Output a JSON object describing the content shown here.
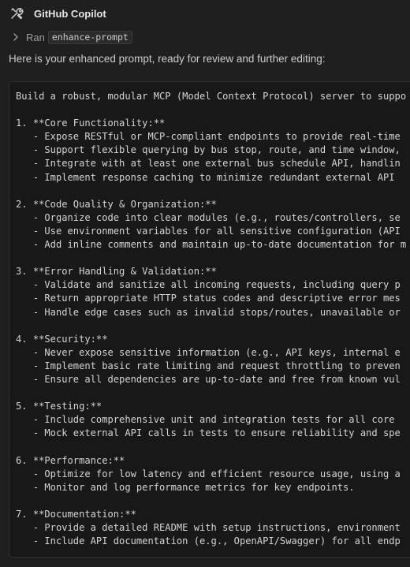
{
  "header": {
    "icon": "copilot-tools-icon",
    "title": "GitHub Copilot"
  },
  "tool_run": {
    "icon": "chevron-right-icon",
    "label": "Ran",
    "command": "enhance-prompt"
  },
  "intro_text": "Here is your enhanced prompt, ready for review and further editing:",
  "code_block": {
    "lines": [
      "Build a robust, modular MCP (Model Context Protocol) server to suppo",
      "",
      "1. **Core Functionality:**",
      "   - Expose RESTful or MCP-compliant endpoints to provide real-time",
      "   - Support flexible querying by bus stop, route, and time window,",
      "   - Integrate with at least one external bus schedule API, handlin",
      "   - Implement response caching to minimize redundant external API",
      "",
      "2. **Code Quality & Organization:**",
      "   - Organize code into clear modules (e.g., routes/controllers, se",
      "   - Use environment variables for all sensitive configuration (API",
      "   - Add inline comments and maintain up-to-date documentation for m",
      "",
      "3. **Error Handling & Validation:**",
      "   - Validate and sanitize all incoming requests, including query p",
      "   - Return appropriate HTTP status codes and descriptive error mes",
      "   - Handle edge cases such as invalid stops/routes, unavailable or",
      "",
      "4. **Security:**",
      "   - Never expose sensitive information (e.g., API keys, internal e",
      "   - Implement basic rate limiting and request throttling to preven",
      "   - Ensure all dependencies are up-to-date and free from known vul",
      "",
      "5. **Testing:**",
      "   - Include comprehensive unit and integration tests for all core",
      "   - Mock external API calls in tests to ensure reliability and spe",
      "",
      "6. **Performance:**",
      "   - Optimize for low latency and efficient resource usage, using a",
      "   - Monitor and log performance metrics for key endpoints.",
      "",
      "7. **Documentation:**",
      "   - Provide a detailed README with setup instructions, environment",
      "   - Include API documentation (e.g., OpenAPI/Swagger) for all endp"
    ]
  }
}
